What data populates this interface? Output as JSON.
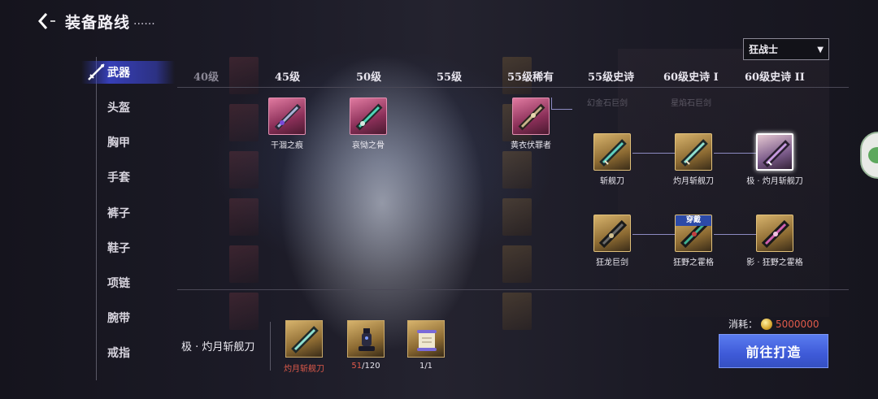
{
  "header": {
    "title": "装备路线",
    "title_suffix": "......"
  },
  "class_select": {
    "value": "狂战士"
  },
  "sidebar": {
    "items": [
      {
        "label": "武器",
        "active": true
      },
      {
        "label": "头盔"
      },
      {
        "label": "胸甲"
      },
      {
        "label": "手套"
      },
      {
        "label": "裤子"
      },
      {
        "label": "鞋子"
      },
      {
        "label": "项链"
      },
      {
        "label": "腕带"
      },
      {
        "label": "戒指"
      }
    ]
  },
  "levels": [
    "40级",
    "45级",
    "50级",
    "55级",
    "55级稀有",
    "55级史诗",
    "60级史诗 I",
    "60级史诗 II"
  ],
  "tree": {
    "ghost_labels": [
      "幻金石巨剑",
      "星焰石巨剑"
    ],
    "items": [
      {
        "name": "干涸之痕",
        "rarity": "pink"
      },
      {
        "name": "哀恸之骨",
        "rarity": "pink"
      },
      {
        "name": "黄衣伏罪者",
        "rarity": "pink"
      },
      {
        "name": "斩舰刀",
        "rarity": "gold"
      },
      {
        "name": "灼月斩舰刀",
        "rarity": "gold"
      },
      {
        "name": "极 · 灼月斩舰刀",
        "rarity": "gold",
        "selected": true
      },
      {
        "name": "狂龙巨剑",
        "rarity": "gold"
      },
      {
        "name": "狂野之霍格",
        "rarity": "gold",
        "badge": "穿戴"
      },
      {
        "name": "影 · 狂野之霍格",
        "rarity": "gold"
      }
    ]
  },
  "craft": {
    "target_name": "极 · 灼月斩舰刀",
    "materials": [
      {
        "label": "灼月斩舰刀"
      },
      {
        "have": "51",
        "need": "/120"
      },
      {
        "label": "1/1"
      }
    ],
    "cost_label": "消耗：",
    "cost_amount": "5000000",
    "button_label": "前往打造"
  },
  "colors": {
    "accent_blue": "#3e5ad8",
    "pink_rarity": "#b84a7a",
    "gold_rarity": "#c9a96a",
    "cost_red": "#e05a4a"
  },
  "icons": {
    "back": "back-chevron-icon",
    "weapon": "sword-icon",
    "coin": "coin-icon",
    "chat": "chat-bubble-icon"
  }
}
